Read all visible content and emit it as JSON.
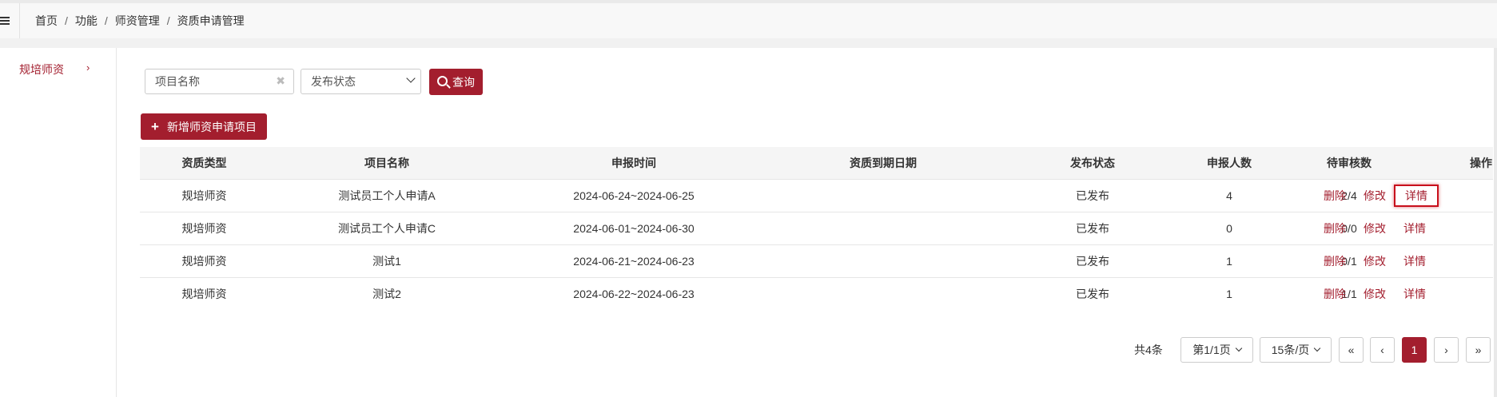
{
  "breadcrumb": [
    "首页",
    "功能",
    "师资管理",
    "资质申请管理"
  ],
  "breadcrumb_sep": "/",
  "sidebar": {
    "items": [
      {
        "label": "规培师资",
        "chevron": "›"
      }
    ]
  },
  "filters": {
    "project_name_placeholder": "项目名称",
    "clear_symbol": "✖",
    "status_placeholder": "发布状态",
    "query_label": "查询"
  },
  "add_button_label": "新增师资申请项目",
  "add_button_icon": "+",
  "table": {
    "headers": [
      "资质类型",
      "项目名称",
      "申报时间",
      "资质到期日期",
      "发布状态",
      "申报人数",
      "待审核数",
      "操作"
    ],
    "rows": [
      {
        "type": "规培师资",
        "name": "测试员工个人申请A",
        "period": "2024-06-24~2024-06-25",
        "expire": "",
        "status": "已发布",
        "applicants": "4",
        "pending": "2/4"
      },
      {
        "type": "规培师资",
        "name": "测试员工个人申请C",
        "period": "2024-06-01~2024-06-30",
        "expire": "",
        "status": "已发布",
        "applicants": "0",
        "pending": "0/0"
      },
      {
        "type": "规培师资",
        "name": "测试1",
        "period": "2024-06-21~2024-06-23",
        "expire": "",
        "status": "已发布",
        "applicants": "1",
        "pending": "0/1"
      },
      {
        "type": "规培师资",
        "name": "测试2",
        "period": "2024-06-22~2024-06-23",
        "expire": "",
        "status": "已发布",
        "applicants": "1",
        "pending": "1/1"
      }
    ],
    "actions": {
      "delete": "删除",
      "edit": "修改",
      "detail": "详情"
    }
  },
  "pagination": {
    "total": "共4条",
    "page_info": "第1/1页",
    "page_size": "15条/页",
    "first": "«",
    "prev": "‹",
    "current": "1",
    "next": "›",
    "last": "»"
  },
  "colors": {
    "accent": "#a31e2e",
    "highlight": "#c8101c"
  }
}
